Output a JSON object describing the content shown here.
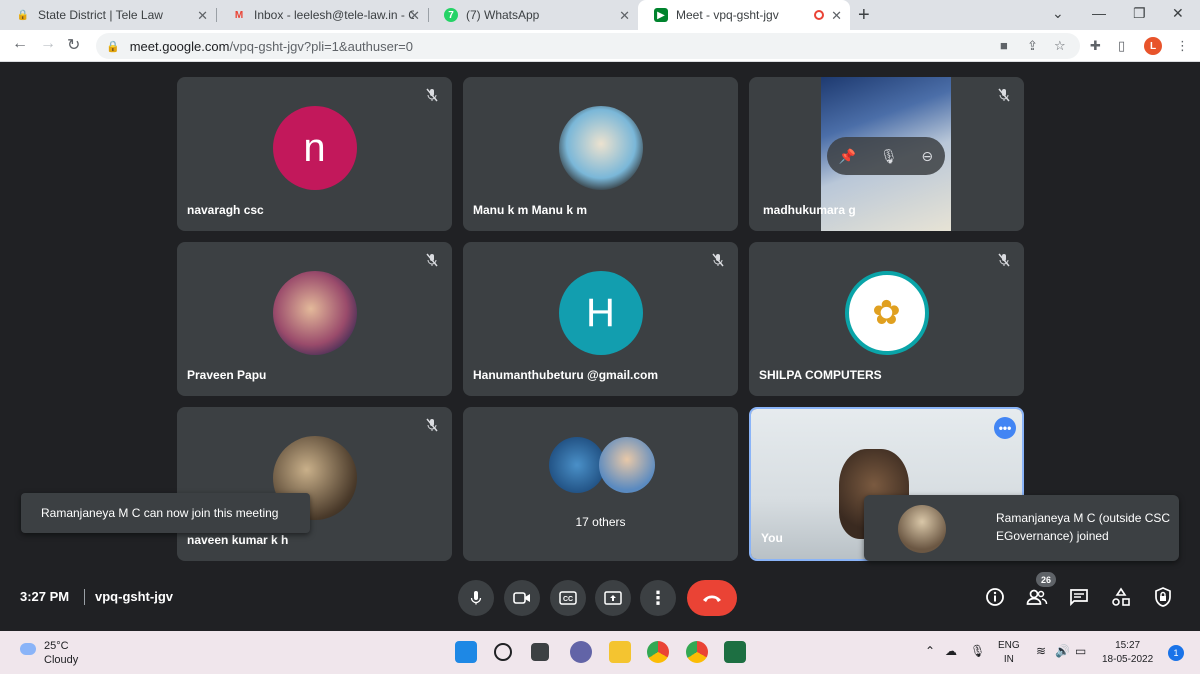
{
  "browser": {
    "tabs": [
      {
        "label": "State District | Tele Law",
        "icon": "lock-icon"
      },
      {
        "label": "Inbox - leelesh@tele-law.in - CSC",
        "icon": "gmail-icon"
      },
      {
        "label": "(7) WhatsApp",
        "icon": "whatsapp-icon",
        "badge": "7"
      },
      {
        "label": "Meet - vpq-gsht-jgv",
        "icon": "meet-icon"
      }
    ],
    "url_host": "meet.google.com",
    "url_path": "/vpq-gsht-jgv?pli=1&authuser=0",
    "profile_initial": "L"
  },
  "meet": {
    "tiles": [
      {
        "name": "navaragh csc",
        "avatar_letter": "n",
        "avatar_color": "#c2185b"
      },
      {
        "name": "Manu k m Manu k m"
      },
      {
        "name": "madhukumara g"
      },
      {
        "name": "Praveen Papu"
      },
      {
        "name": "Hanumanthubeturu @gmail.com",
        "avatar_letter": "H",
        "avatar_color": "#129eaf"
      },
      {
        "name": "SHILPA COMPUTERS"
      },
      {
        "name": "naveen kumar k h"
      },
      {
        "others_label": "17 others"
      },
      {
        "name": "You"
      }
    ],
    "toast_left": "Ramanjaneya M C can now join this meeting",
    "toast_right": "Ramanjaneya M C (outside CSC EGovernance) joined",
    "time": "3:27 PM",
    "meeting_code": "vpq-gsht-jgv",
    "participant_count": "26"
  },
  "taskbar": {
    "temperature": "25°C",
    "weather": "Cloudy",
    "lang_top": "ENG",
    "lang_bottom": "IN",
    "clock_time": "15:27",
    "clock_date": "18-05-2022",
    "notification_count": "1"
  },
  "colors": {
    "end_call": "#ea4335",
    "accent": "#4285f4",
    "meet_bg": "#202124",
    "tile_bg": "#3c4043"
  }
}
